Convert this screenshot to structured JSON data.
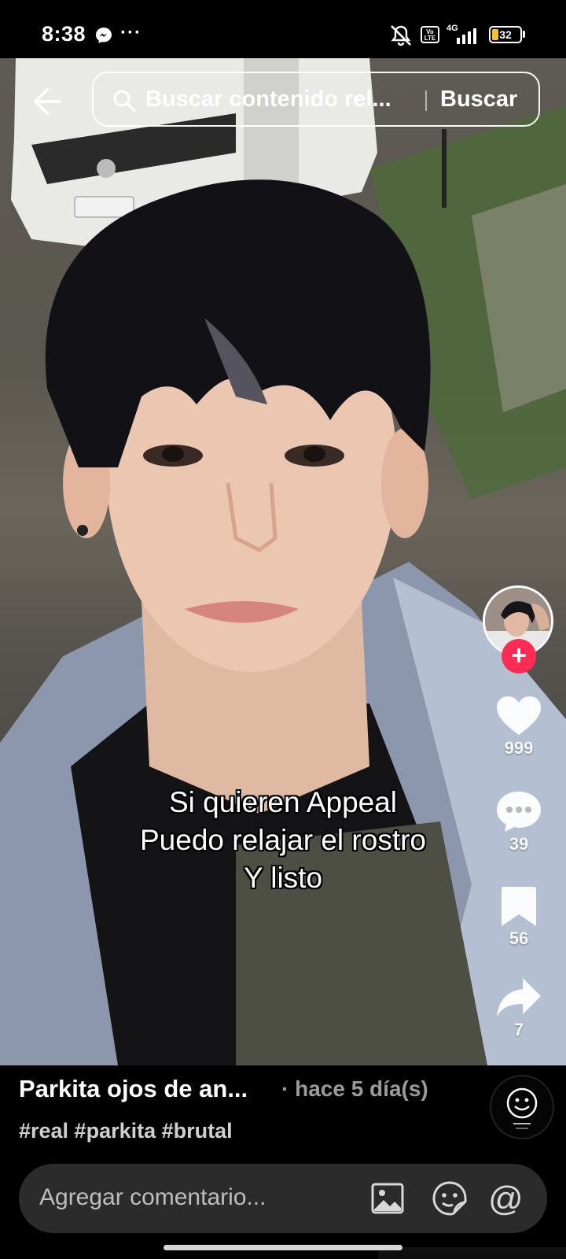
{
  "status_bar": {
    "time": "8:38",
    "more": "···",
    "volte": "Vo LTE",
    "network": "4G",
    "battery": "32",
    "battery_level": 0.32,
    "icons": [
      "messenger-icon",
      "mute-icon",
      "volte-icon",
      "signal-icon",
      "battery-icon"
    ]
  },
  "header": {
    "back_icon": "arrow-left-icon",
    "search_icon": "search-icon",
    "search_query": "Buscar contenido rel...",
    "search_button": "Buscar"
  },
  "video": {
    "caption_lines": [
      "Si quieren Appeal",
      "Puedo relajar el rostro",
      "Y listo"
    ]
  },
  "rail": {
    "follow_icon": "plus-icon",
    "like_icon": "heart-icon",
    "likes": "999",
    "comment_icon": "comment-bubble-icon",
    "comments": "39",
    "save_icon": "bookmark-icon",
    "saves": "56",
    "share_icon": "share-arrow-icon",
    "shares": "7"
  },
  "description": {
    "title": "Parkita ojos de an...",
    "time": "· hace 5 día(s)",
    "hashtags": "#real #parkita #brutal"
  },
  "comment_bar": {
    "placeholder": "Agregar comentario...",
    "image_icon": "image-icon",
    "sticker_icon": "sticker-icon",
    "mention": "@"
  },
  "colors": {
    "accent": "#fe2c55",
    "battery": "#f2c230",
    "comment_bar": "#2b2b2b"
  }
}
